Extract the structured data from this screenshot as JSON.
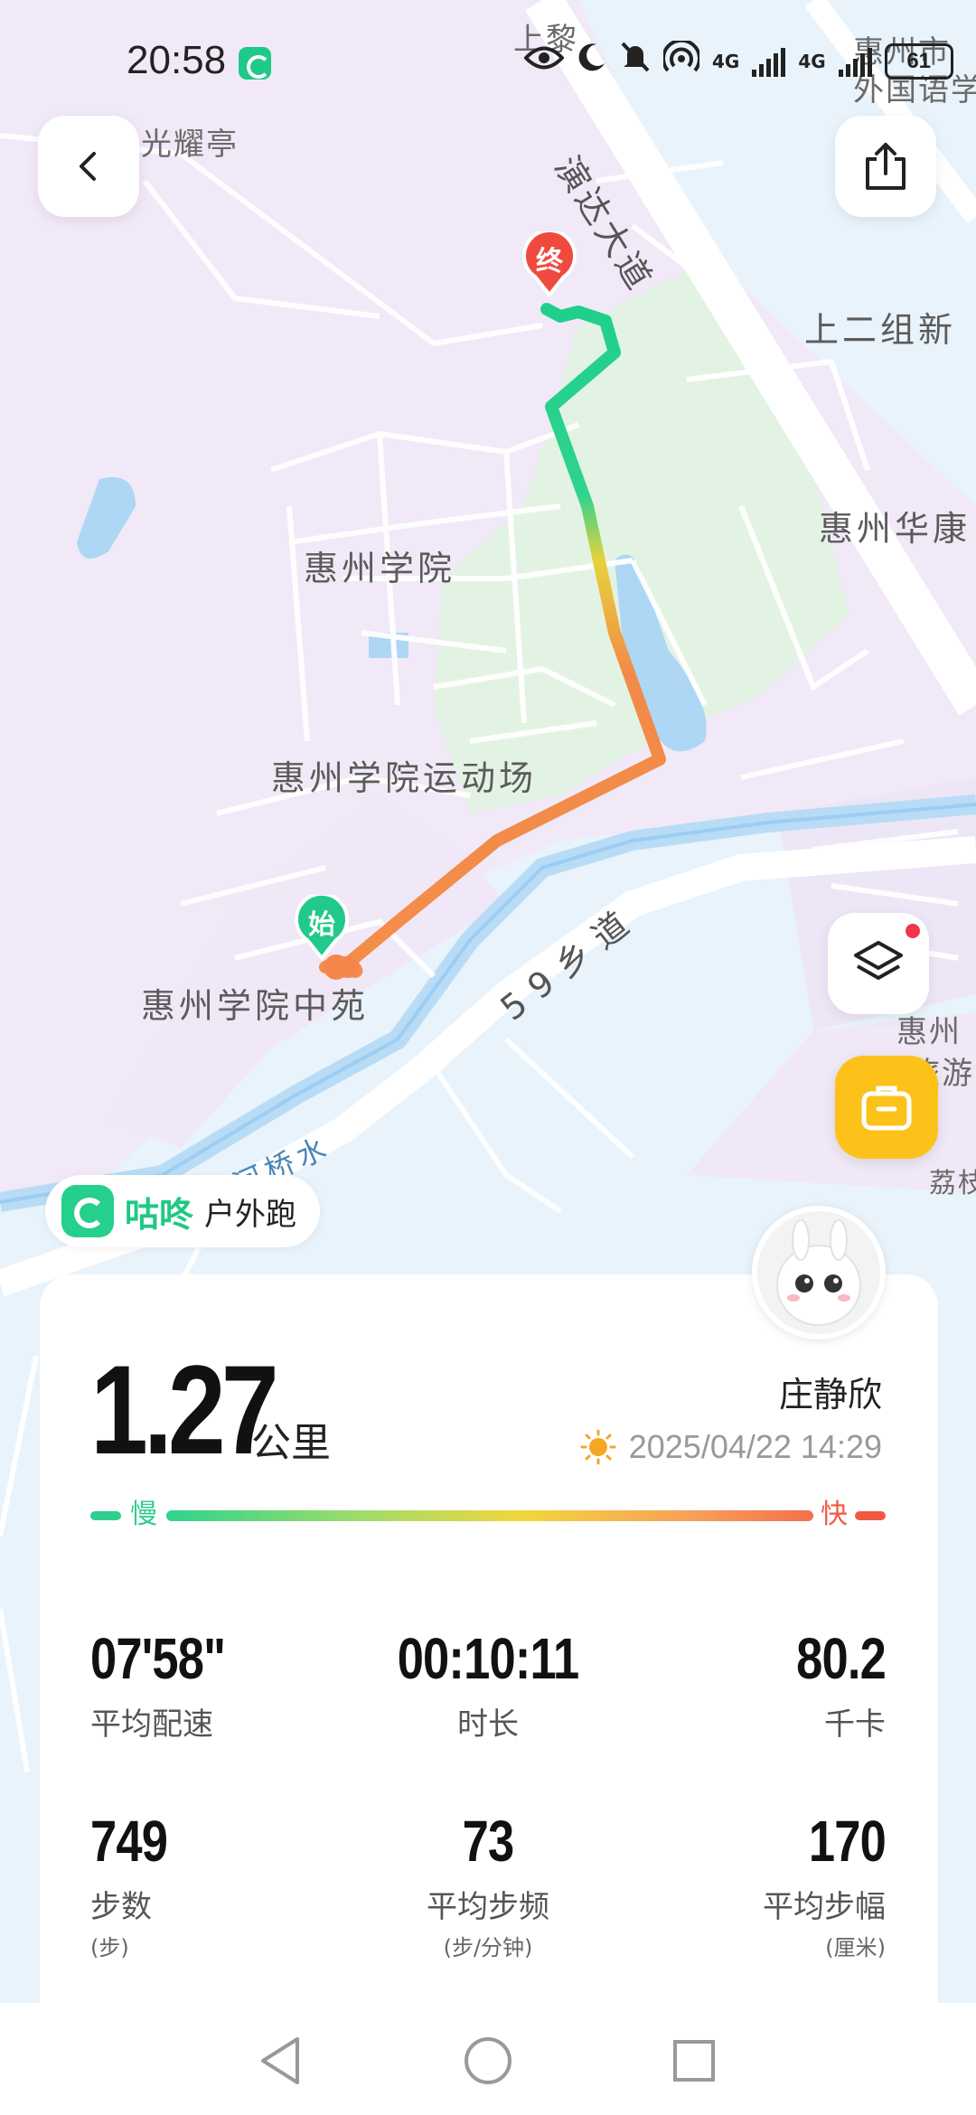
{
  "status_bar": {
    "time": "20:58",
    "network_1": "4G",
    "network_2": "4G",
    "battery": "61"
  },
  "map": {
    "labels": {
      "guangyaoting": "光耀亭",
      "shangli": "上黎",
      "yandadadao": "演达大道",
      "huizhou_city": "惠州市",
      "foreign_lang": "外国语学",
      "shangerzu": "上二组新",
      "huizhou_huakang": "惠州华康",
      "huizhou_xueyuan": "惠州学院",
      "sports_field": "惠州学院运动场",
      "zhongyuan": "惠州学院中苑",
      "road_59": "59乡道",
      "river": "河桥水",
      "huizhou_right": "惠州",
      "lv_you": "旅游",
      "lizhi": "荔枝"
    },
    "start_marker": "始",
    "end_marker": "终"
  },
  "brand": {
    "name": "咕咚",
    "activity": "户外跑"
  },
  "summary": {
    "distance": "1.27",
    "distance_unit": "公里",
    "username": "庄静欣",
    "datetime": "2025/04/22 14:29",
    "pace_slow": "慢",
    "pace_fast": "快"
  },
  "stats": {
    "avg_pace": {
      "value": "07'58\"",
      "label": "平均配速"
    },
    "duration": {
      "value": "00:10:11",
      "label": "时长"
    },
    "calories": {
      "value": "80.2",
      "label": "千卡"
    },
    "steps": {
      "value": "749",
      "label": "步数",
      "unit": "(步)"
    },
    "cadence": {
      "value": "73",
      "label": "平均步频",
      "unit": "(步/分钟)"
    },
    "stride": {
      "value": "170",
      "label": "平均步幅",
      "unit": "(厘米)"
    }
  },
  "colors": {
    "brand_green": "#1fc983",
    "slow": "#2fce8e",
    "fast": "#f05a43",
    "bag_button": "#fcc21a"
  }
}
